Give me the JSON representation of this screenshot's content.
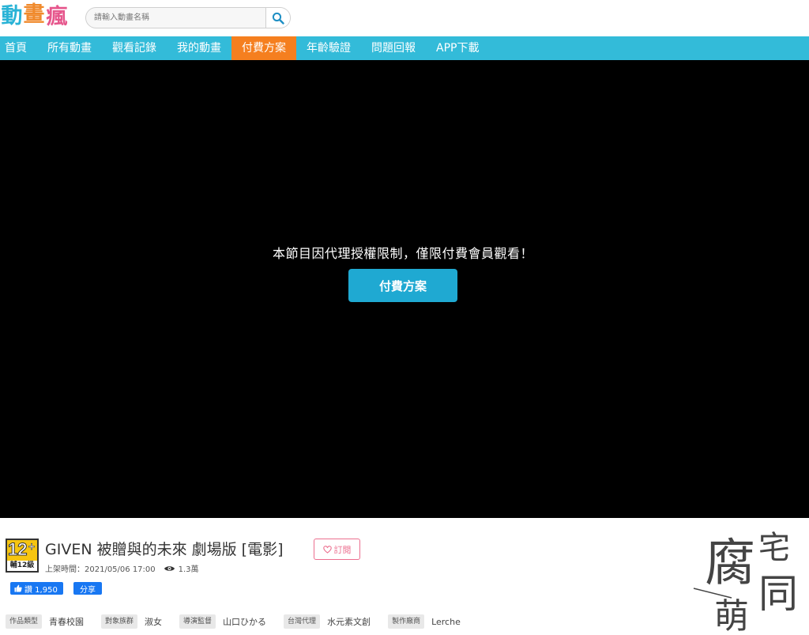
{
  "logo": {
    "chars": [
      "動",
      "畫",
      "瘋"
    ]
  },
  "search": {
    "placeholder": "請輸入動畫名稱"
  },
  "nav": {
    "items": [
      {
        "label": "首頁"
      },
      {
        "label": "所有動畫"
      },
      {
        "label": "觀看記錄"
      },
      {
        "label": "我的動畫"
      },
      {
        "label": "付費方案"
      },
      {
        "label": "年齡驗證"
      },
      {
        "label": "問題回報"
      },
      {
        "label": "APP下載"
      }
    ],
    "active_index": 4
  },
  "player": {
    "message": "本節目因代理授權限制，僅限付費會員觀看！",
    "button_label": "付費方案"
  },
  "info": {
    "rating": {
      "age": "12",
      "plus": "+",
      "label": "輔12級",
      "color": "#f6c510"
    },
    "title": "GIVEN 被贈與的未來 劇場版 [電影]",
    "subscribe_label": "訂閱",
    "release": "上架時間：2021/05/06 17:00",
    "views": "1.3萬",
    "like_label": "讚 1,950",
    "share_label": "分享",
    "tags": [
      {
        "key": "作品類型",
        "value": "青春校園"
      },
      {
        "key": "對象族群",
        "value": "淑女"
      },
      {
        "key": "導演監督",
        "value": "山口ひかる"
      },
      {
        "key": "台灣代理",
        "value": "水元素文創"
      },
      {
        "key": "製作廠商",
        "value": "Lerche"
      }
    ]
  },
  "badge": {
    "chars": [
      "腐",
      "宅",
      "萌",
      "同"
    ]
  },
  "colors": {
    "nav_bg": "#33bbd9",
    "nav_active": "#f57f1f",
    "pay_button": "#1fa9d2",
    "subscribe": "#ec6f8f",
    "facebook": "#1877f2"
  }
}
